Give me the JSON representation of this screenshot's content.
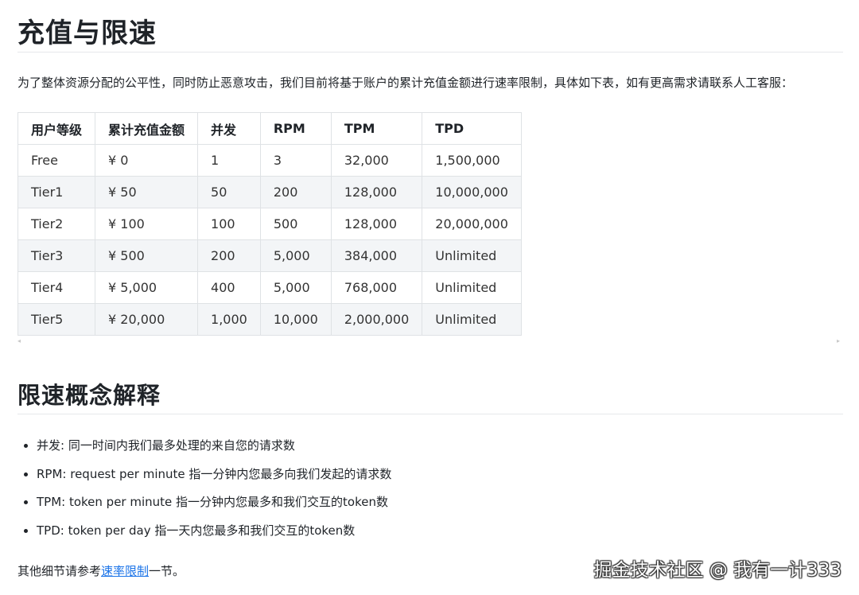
{
  "title": "充值与限速",
  "intro": "为了整体资源分配的公平性，同时防止恶意攻击，我们目前将基于账户的累计充值金额进行速率限制，具体如下表，如有更高需求请联系人工客服：",
  "table": {
    "headers": [
      "用户等级",
      "累计充值金额",
      "并发",
      "RPM",
      "TPM",
      "TPD"
    ],
    "rows": [
      [
        "Free",
        "¥ 0",
        "1",
        "3",
        "32,000",
        "1,500,000"
      ],
      [
        "Tier1",
        "¥ 50",
        "50",
        "200",
        "128,000",
        "10,000,000"
      ],
      [
        "Tier2",
        "¥ 100",
        "100",
        "500",
        "128,000",
        "20,000,000"
      ],
      [
        "Tier3",
        "¥ 500",
        "200",
        "5,000",
        "384,000",
        "Unlimited"
      ],
      [
        "Tier4",
        "¥ 5,000",
        "400",
        "5,000",
        "768,000",
        "Unlimited"
      ],
      [
        "Tier5",
        "¥ 20,000",
        "1,000",
        "10,000",
        "2,000,000",
        "Unlimited"
      ]
    ]
  },
  "scroll": {
    "left_arrow": "◂",
    "right_arrow": "▸"
  },
  "section_title": "限速概念解释",
  "concepts": [
    "并发: 同一时间内我们最多处理的来自您的请求数",
    "RPM: request per minute 指一分钟内您最多向我们发起的请求数",
    "TPM: token per minute 指一分钟内您最多和我们交互的token数",
    "TPD: token per day 指一天内您最多和我们交互的token数"
  ],
  "footer": {
    "prefix": "其他细节请参考",
    "link": "速率限制",
    "suffix": "一节。"
  },
  "watermark": "掘金技术社区 @ 我有一计333"
}
